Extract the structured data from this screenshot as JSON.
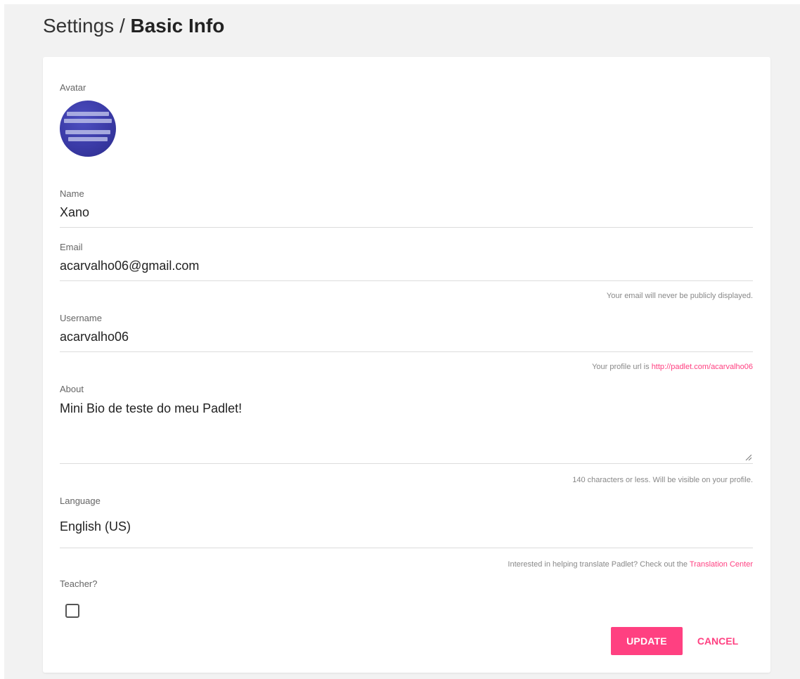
{
  "breadcrumb": {
    "parent": "Settings",
    "separator": "/",
    "current": "Basic Info"
  },
  "avatar": {
    "label": "Avatar"
  },
  "name": {
    "label": "Name",
    "value": "Xano"
  },
  "email": {
    "label": "Email",
    "value": "acarvalho06@gmail.com",
    "hint": "Your email will never be publicly displayed."
  },
  "username": {
    "label": "Username",
    "value": "acarvalho06",
    "hint_prefix": "Your profile url is",
    "hint_link": "http://padlet.com/acarvalho06"
  },
  "about": {
    "label": "About",
    "value": "Mini Bio de teste do meu Padlet!",
    "hint": "140 characters or less. Will be visible on your profile."
  },
  "language": {
    "label": "Language",
    "value": "English (US)",
    "hint_prefix": "Interested in helping translate Padlet? Check out the",
    "hint_link": "Translation Center"
  },
  "teacher": {
    "label": "Teacher?",
    "checked": false
  },
  "actions": {
    "update_label": "UPDATE",
    "cancel_label": "CANCEL"
  },
  "colors": {
    "accent": "#ff4081",
    "background": "#f2f2f2",
    "card": "#ffffff"
  }
}
